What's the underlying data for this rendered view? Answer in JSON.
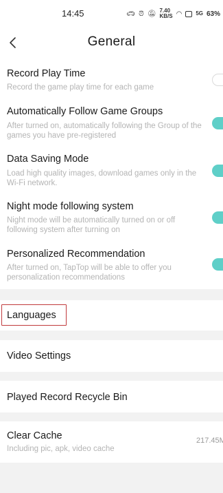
{
  "status_bar": {
    "time": "14:45",
    "data_speed_top": "7.40",
    "data_speed_bottom": "KB/S",
    "battery": "63%",
    "signal": "5G"
  },
  "header": {
    "title": "General"
  },
  "settings": [
    {
      "title": "Record Play Time",
      "description": "Record the game play time for each game",
      "enabled": false
    },
    {
      "title": "Automatically Follow Game Groups",
      "description": "After turned on, automatically following the Group of the games you have pre-registered",
      "enabled": true
    },
    {
      "title": "Data Saving Mode",
      "description": "Load high quality images, download games only in the Wi-Fi network.",
      "enabled": true
    },
    {
      "title": "Night mode following system",
      "description": "Night mode will be automatically turned on or off following system after turning on",
      "enabled": true
    },
    {
      "title": "Personalized Recommendation",
      "description": "After turned on, TapTop will be able to offer you personalization recommendations",
      "enabled": true
    }
  ],
  "sections": {
    "languages": "Languages",
    "video_settings": "Video Settings",
    "recycle_bin": "Played Record Recycle Bin",
    "clear_cache": "Clear Cache",
    "clear_cache_desc": "Including pic, apk, video cache",
    "cache_size": "217.45M"
  },
  "colors": {
    "toggle_on": "#5fcfc8",
    "highlight_box": "#c0393b"
  }
}
